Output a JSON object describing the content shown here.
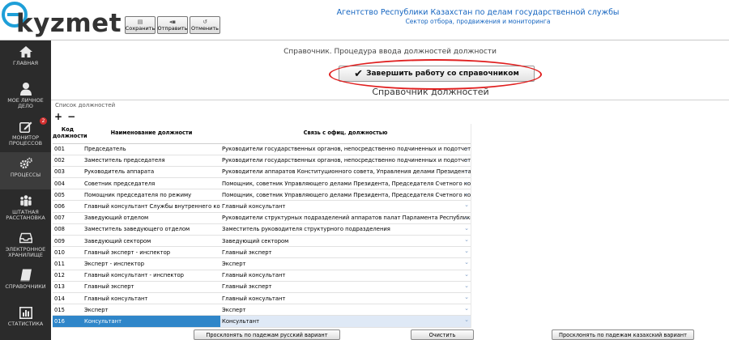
{
  "logo": {
    "text": "kyzmet",
    "icon": "e-circle-logo"
  },
  "toolbar": {
    "buttons": [
      {
        "label": "Сохранить",
        "icon": "save-icon"
      },
      {
        "label": "Отправить",
        "icon": "send-icon"
      },
      {
        "label": "Отменить",
        "icon": "undo-icon"
      }
    ]
  },
  "org": {
    "title": "Агентство Республики Казахстан по делам государственной службы",
    "subtitle": "Сектор отбора, продвижения и мониторинга"
  },
  "sidebar": {
    "items": [
      {
        "label": "ГЛАВНАЯ",
        "icon": "home-icon"
      },
      {
        "label": "МОЕ ЛИЧНОЕ\nДЕЛО",
        "icon": "user-icon"
      },
      {
        "label": "МОНИТОР\nПРОЦЕССОВ",
        "icon": "edit-icon",
        "badge": "2"
      },
      {
        "label": "ПРОЦЕССЫ",
        "icon": "gears-icon",
        "active": true
      },
      {
        "label": "ШТАТНАЯ\nРАССТАНОВКА",
        "icon": "people-icon"
      },
      {
        "label": "ЭЛЕКТРОННОЕ\nХРАНИЛИЩЕ",
        "icon": "inbox-icon"
      },
      {
        "label": "СПРАВОЧНИКИ",
        "icon": "book-icon"
      },
      {
        "label": "СТАТИСТИКА",
        "icon": "chart-icon"
      }
    ]
  },
  "main": {
    "directory_title": "Справочник. Процедура ввода должностей должности",
    "finish_button": "Завершить работу со справочником",
    "subtitle": "Справочник должностей",
    "list_label": "Список должностей",
    "add": "+",
    "remove": "−",
    "table": {
      "headers": {
        "code": "Код должности",
        "name": "Наименование должности",
        "link": "Связь с офиц. должностью"
      },
      "rows": [
        {
          "code": "001",
          "name": "Председатель",
          "link": "Руководители государственных органов, непосредственно подчиненных и подотчетных Президенту"
        },
        {
          "code": "002",
          "name": "Заместитель председателя",
          "link": "Руководители государственных органов, непосредственно подчиненных и подотчетных Президенту"
        },
        {
          "code": "003",
          "name": "Руководитель аппарата",
          "link": "Руководители аппаратов Конституционного совета, Управления делами Президента"
        },
        {
          "code": "004",
          "name": "Советник председателя",
          "link": "Помощник, советник Управляющего делами Президента, Председателя Счетного комитета"
        },
        {
          "code": "005",
          "name": "Помощник председателя по режиму",
          "link": "Помощник, советник Управляющего делами Президента, Председателя Счетного комитета"
        },
        {
          "code": "006",
          "name": "Главный консультант Службы внутреннего контроля",
          "link": "Главный консультант"
        },
        {
          "code": "007",
          "name": "Заведующий отделом",
          "link": "Руководители структурных подразделений аппаратов палат Парламента Республики Казахстан"
        },
        {
          "code": "008",
          "name": "Заместитель заведующего отделом",
          "link": "Заместитель руководителя структурного подразделения"
        },
        {
          "code": "009",
          "name": "Заведующий сектором",
          "link": "Заведующий сектором"
        },
        {
          "code": "010",
          "name": "Главный эксперт - инспектор",
          "link": "Главный эксперт"
        },
        {
          "code": "011",
          "name": "Эксперт - инспектор",
          "link": "Эксперт"
        },
        {
          "code": "012",
          "name": "Главный консультант - инспектор",
          "link": "Главный консультант"
        },
        {
          "code": "013",
          "name": "Главный эксперт",
          "link": "Главный эксперт"
        },
        {
          "code": "014",
          "name": "Главный консультант",
          "link": "Главный консультант"
        },
        {
          "code": "015",
          "name": "Эксперт",
          "link": "Эксперт"
        },
        {
          "code": "016",
          "name": "Консультант",
          "link": "Консультант",
          "selected": true
        }
      ]
    },
    "buttons": {
      "decline_ru": "Просклонять по падежам русский вариант",
      "clear": "Очистить",
      "decline_kz": "Просклонять по падежам казахский вариант"
    }
  },
  "colors": {
    "accent": "#1e9fd8",
    "sidebar": "#2b2b2b",
    "selection": "#2f86c9",
    "highlight": "#e02020",
    "org_text": "#1565c0"
  }
}
